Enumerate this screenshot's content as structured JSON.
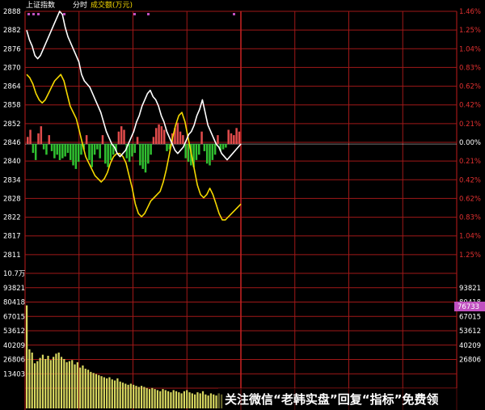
{
  "header": {
    "index_name": "上证指数",
    "mode": "分时",
    "volume_label": "成交额(万元)"
  },
  "colors": {
    "grid": "#a01818",
    "price_line": "#ffffff",
    "avg_line": "#f5d800",
    "up_bar": "#e04b4b",
    "down_bar": "#30c030",
    "volume_bar": "#d8d860",
    "left_label": "#ffffff",
    "right_label": "#e03030",
    "badge_bg": "#c050c0",
    "badge_text": "#ffffff"
  },
  "price_panel": {
    "left_ticks": [
      "2888",
      "2882",
      "2876",
      "2870",
      "2864",
      "2858",
      "2852",
      "2846",
      "2840",
      "2834",
      "2828",
      "2822",
      "2817",
      "2811"
    ],
    "right_ticks": [
      "1.46%",
      "1.25%",
      "1.04%",
      "0.83%",
      "0.62%",
      "0.42%",
      "0.21%",
      "0.00%",
      "0.21%",
      "0.42%",
      "0.62%",
      "0.83%",
      "1.04%",
      "1.25%"
    ],
    "ylim": [
      2811,
      2888
    ],
    "base_price": 2846,
    "price_series": [
      2882,
      2879,
      2877,
      2874,
      2873,
      2874,
      2876,
      2878,
      2880,
      2882,
      2884,
      2886,
      2888,
      2887,
      2883,
      2880,
      2878,
      2876,
      2874,
      2872,
      2868,
      2866,
      2865,
      2864,
      2862,
      2860,
      2858,
      2856,
      2853,
      2850,
      2848,
      2846,
      2845,
      2843,
      2842,
      2843,
      2844,
      2846,
      2848,
      2850,
      2853,
      2855,
      2858,
      2860,
      2862,
      2863,
      2861,
      2860,
      2858,
      2855,
      2853,
      2850,
      2848,
      2846,
      2844,
      2843,
      2844,
      2845,
      2847,
      2849,
      2850,
      2852,
      2855,
      2857,
      2860,
      2856,
      2852,
      2850,
      2848,
      2846,
      2845,
      2843,
      2842,
      2841,
      2842,
      2843,
      2844,
      2845,
      2846
    ],
    "avg_series": [
      2868,
      2867,
      2865,
      2862,
      2860,
      2859,
      2860,
      2862,
      2864,
      2866,
      2867,
      2868,
      2866,
      2862,
      2858,
      2856,
      2854,
      2850,
      2846,
      2842,
      2840,
      2838,
      2836,
      2835,
      2834,
      2835,
      2837,
      2840,
      2842,
      2843,
      2843,
      2842,
      2840,
      2836,
      2832,
      2827,
      2824,
      2823,
      2824,
      2826,
      2828,
      2829,
      2830,
      2831,
      2834,
      2838,
      2843,
      2848,
      2852,
      2855,
      2856,
      2853,
      2848,
      2843,
      2838,
      2833,
      2830,
      2829,
      2830,
      2832,
      2830,
      2827,
      2824,
      2822,
      2822,
      2823,
      2824,
      2825,
      2826,
      2827
    ],
    "breadth_series": [
      4,
      8,
      -5,
      -9,
      6,
      10,
      -3,
      -6,
      5,
      -4,
      -8,
      -6,
      -9,
      -8,
      -7,
      -5,
      -9,
      -12,
      -14,
      -10,
      -6,
      -3,
      5,
      -9,
      -13,
      -6,
      -3,
      -8,
      5,
      -11,
      -13,
      -9,
      -6,
      -4,
      7,
      10,
      8,
      -8,
      -10,
      -7,
      -5,
      4,
      -12,
      -14,
      -16,
      -11,
      -6,
      4,
      9,
      11,
      10,
      8,
      -4,
      -3,
      6,
      9,
      12,
      7,
      5,
      -8,
      -10,
      -12,
      -13,
      -9,
      -6,
      7,
      -4,
      -11,
      -12,
      -9,
      -6,
      5,
      -4,
      -3,
      -2,
      8,
      6,
      5,
      9,
      7
    ]
  },
  "volume_panel": {
    "left_ticks": [
      "10.7万",
      "93821",
      "80418",
      "67015",
      "53612",
      "40209",
      "26806",
      "13403"
    ],
    "right_ticks": [
      "93821",
      "80418",
      "67015",
      "53612",
      "40209",
      "26806"
    ],
    "current_value_badge": "76733",
    "ylim": [
      0,
      107000
    ],
    "volume_series": [
      96000,
      55000,
      52000,
      42000,
      44000,
      47000,
      50000,
      46000,
      49000,
      45000,
      48000,
      51000,
      52000,
      48000,
      46000,
      43000,
      44000,
      45000,
      41000,
      43000,
      38000,
      40000,
      37000,
      36000,
      34000,
      33000,
      32000,
      31000,
      30000,
      29000,
      28000,
      29000,
      27000,
      26000,
      28000,
      25000,
      24000,
      23000,
      22000,
      23000,
      22000,
      21000,
      20000,
      21000,
      20000,
      19000,
      18000,
      19000,
      18000,
      17000,
      16000,
      18000,
      17000,
      16000,
      15000,
      17000,
      16000,
      15000,
      14000,
      16000,
      17000,
      15000,
      14000,
      13000,
      15000,
      14000,
      16000,
      13000,
      12000,
      14000,
      13000,
      12000,
      14000,
      13000,
      12000,
      11000
    ]
  },
  "watermark": "关注微信“老韩实盘”回复“指标”免费领"
}
